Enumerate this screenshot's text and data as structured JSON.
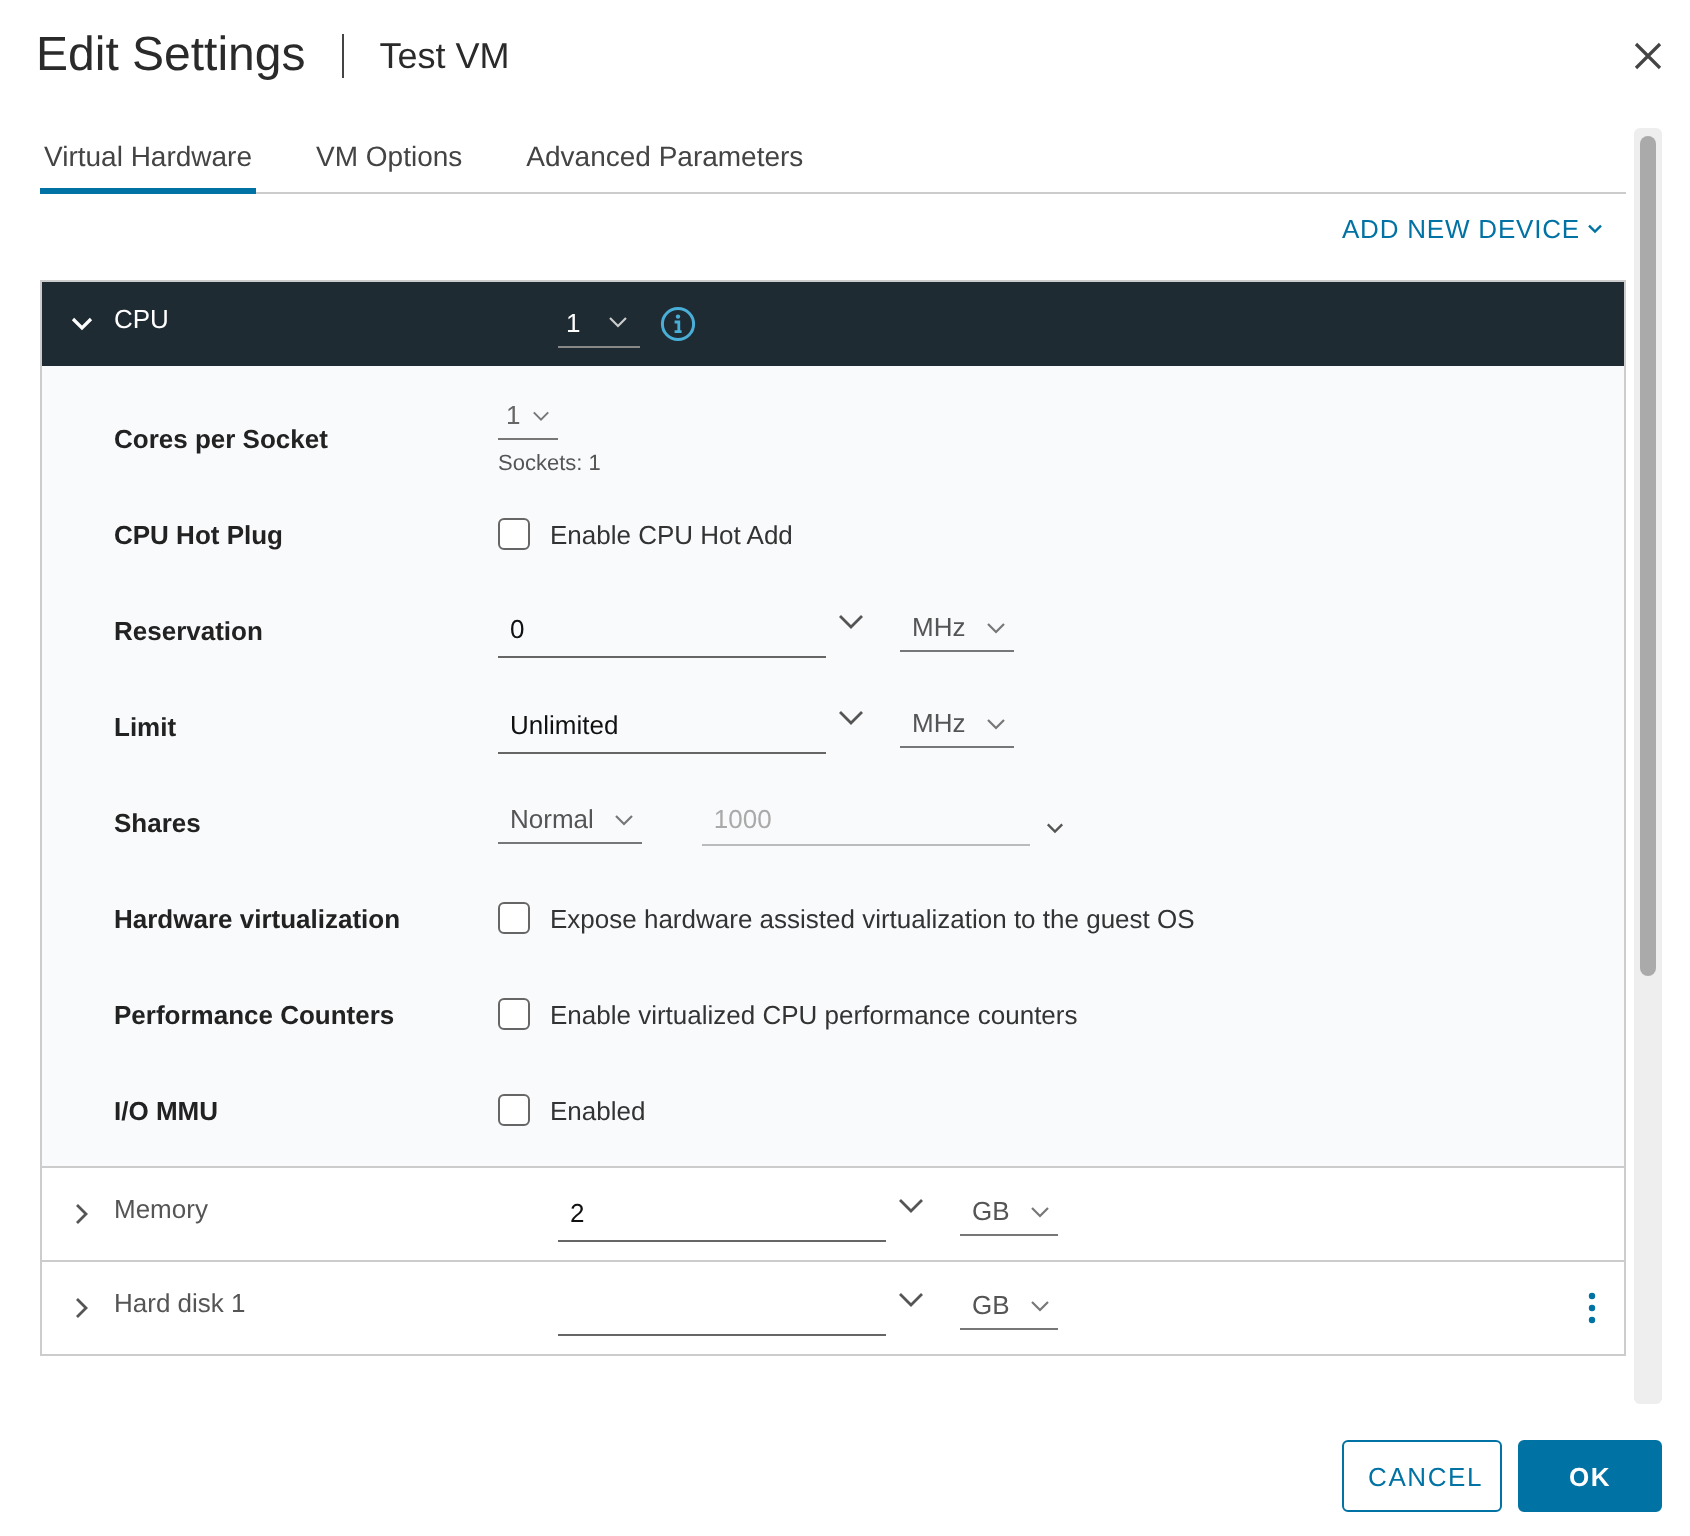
{
  "dialog": {
    "title": "Edit Settings",
    "subtitle": "Test VM"
  },
  "tabs": [
    {
      "label": "Virtual Hardware",
      "selected": true
    },
    {
      "label": "VM Options",
      "selected": false
    },
    {
      "label": "Advanced Parameters",
      "selected": false
    }
  ],
  "add_device": "ADD NEW DEVICE",
  "cpu": {
    "label": "CPU",
    "expanded": true,
    "value": "1"
  },
  "cpu_settings": [
    {
      "kind": "select",
      "label": "Cores per Socket",
      "value": "1",
      "note": "Sockets: 1"
    },
    {
      "kind": "checkbox",
      "label": "CPU Hot Plug",
      "text": "Enable CPU Hot Add",
      "checked": false
    },
    {
      "kind": "combo",
      "label": "Reservation",
      "value": "0",
      "unit": "MHz"
    },
    {
      "kind": "combo",
      "label": "Limit",
      "value": "Unlimited",
      "unit": "MHz"
    },
    {
      "kind": "shares",
      "label": "Shares",
      "value": "Normal",
      "amount": "1000",
      "disabled": true
    },
    {
      "kind": "checkbox",
      "label": "Hardware virtualization",
      "text": "Expose hardware assisted virtualization to the guest OS",
      "checked": false
    },
    {
      "kind": "checkbox",
      "label": "Performance Counters",
      "text": "Enable virtualized CPU performance counters",
      "checked": false
    },
    {
      "kind": "checkbox",
      "label": "I/O MMU",
      "text": "Enabled",
      "checked": false
    }
  ],
  "devices": [
    {
      "label": "Memory",
      "expanded": false,
      "value": "2",
      "unit": "GB",
      "has_menu": false
    },
    {
      "label": "Hard disk 1",
      "expanded": false,
      "unit": "GB",
      "has_menu": true
    }
  ],
  "buttons": [
    {
      "label": "CANCEL",
      "kind": "secondary"
    },
    {
      "label": "OK",
      "kind": "primary"
    }
  ]
}
